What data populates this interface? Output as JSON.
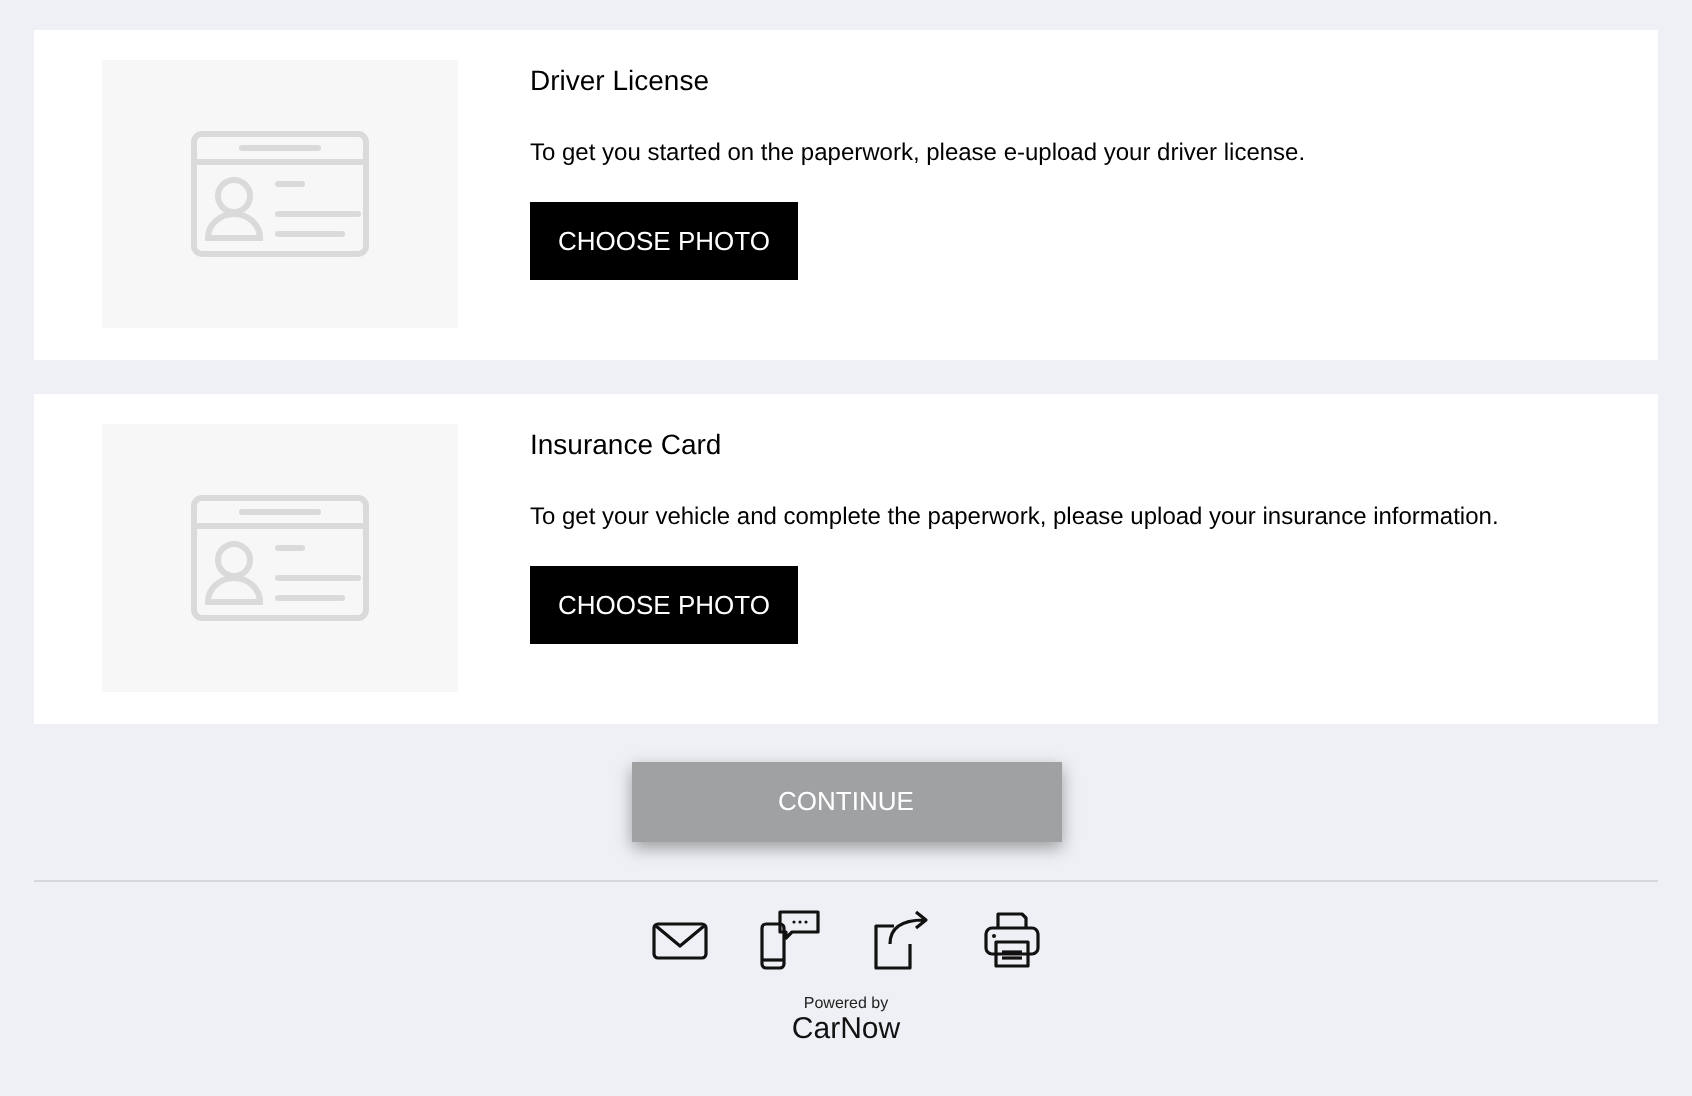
{
  "documents": [
    {
      "title": "Driver License",
      "description": "To get you started on the paperwork, please e-upload your driver license.",
      "button": "CHOOSE PHOTO"
    },
    {
      "title": "Insurance Card",
      "description": "To get your vehicle and complete the paperwork, please upload your insurance information.",
      "button": "CHOOSE PHOTO"
    }
  ],
  "continue_button": {
    "label": "CONTINUE",
    "disabled": true
  },
  "footer": {
    "powered_by": "Powered by",
    "brand": "CarNow"
  }
}
